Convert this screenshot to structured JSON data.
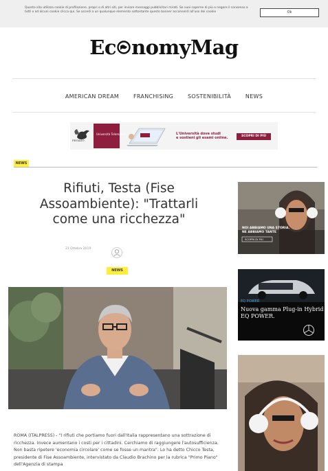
{
  "cookie": {
    "text": "Questo sito utilizza cookie di profilazione, propri o di altri siti, per inviare messaggi pubblicitari mirati. Se vuoi saperne di più o negare il consenso a tutti o ad alcuni cookie clicca qui. Se accedi a un qualunque elemento sottostante questo banner acconsenti all'uso dei cookie",
    "ok_label": "Ok"
  },
  "site": {
    "logo_before": "Ec",
    "logo_after": "nomyMag"
  },
  "nav": {
    "items": [
      "AMERICAN DREAM",
      "FRANCHISING",
      "SOSTENIBILITÀ",
      "NEWS"
    ]
  },
  "banner": {
    "brand": "PEGASO",
    "uni_label": "Università Telematica",
    "headline_1": "L'Università dove studi",
    "headline_2": "e sostieni gli esami online.",
    "cta": "SCOPRI DI PIÙ"
  },
  "section": {
    "tag": "NEWS"
  },
  "article": {
    "title": "Rifiuti, Testa (Fise Assoambiente): \"Trattarli come una ricchezza\"",
    "date": "21 Ottobre 2019",
    "tag": "NEWS",
    "body": "ROMA (ITALPRESS) - \"I rifiuti che portiamo fuori dall'Italia rappresentano una sottrazione di ricchezza. Invece aumentano i costi per i cittadini. Cerchiamo di raggiungere l'autosufficienza. Non basta ripetere 'economia circolare' come se fosse un mantra\". Lo ha detto Chicco Testa, presidente di Fise Assoambiente, intervistato da Claudio Brachino per la rubrica \"Primo Piano\" dell'Agenzia di stampa"
  },
  "ads": {
    "ad1_caption": "NOI ABBIAMO UNA STORIA. NE ABBIAMO TANTE",
    "ad1_link": "SCOPRI DI PIÙ",
    "ad2_brand": "EQ POWER",
    "ad2_line1": "Nuova gamma Plug-in Hybrid",
    "ad2_line2": "EQ POWER."
  },
  "colors": {
    "tag_yellow": "#ffef3a",
    "pegaso_red": "#8e1e3e",
    "ad_dark": "#0a0a0a"
  }
}
